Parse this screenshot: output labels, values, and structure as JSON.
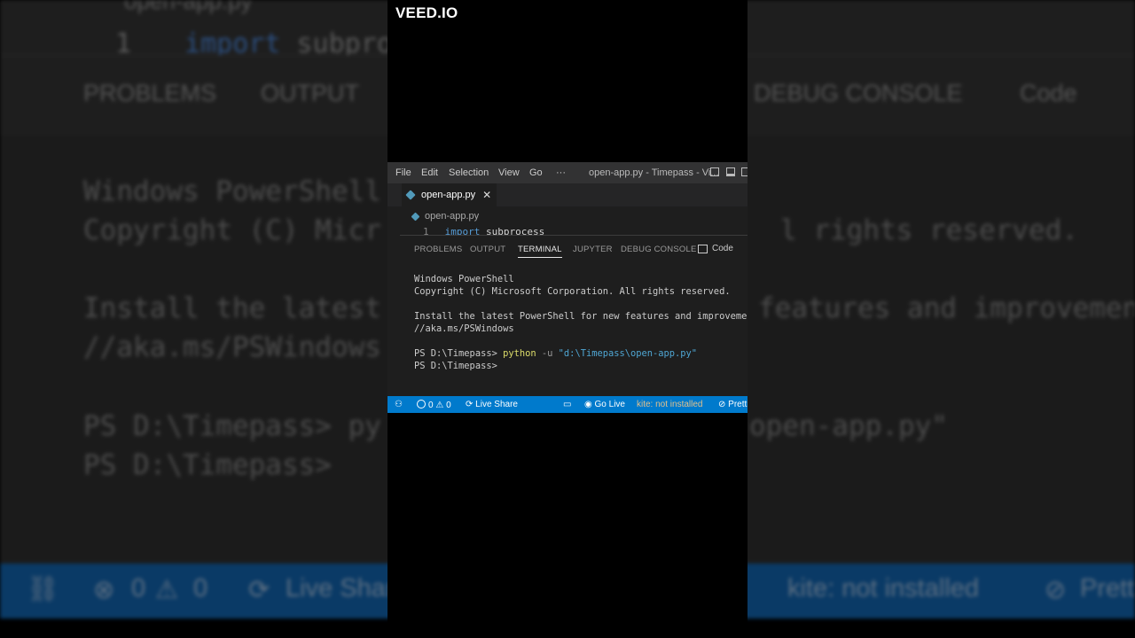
{
  "watermark": "VEED.IO",
  "menu": {
    "file": "File",
    "edit": "Edit",
    "selection": "Selection",
    "view": "View",
    "go": "Go",
    "more": "···"
  },
  "window_title": "open-app.py - Timepass - Vi...",
  "tab": {
    "label": "open-app.py",
    "close": "✕"
  },
  "breadcrumb": "open-app.py",
  "code_line": {
    "number": "1",
    "keyword": "import",
    "module": "subprocess"
  },
  "panel_tabs": {
    "problems": "PROBLEMS",
    "output": "OUTPUT",
    "terminal": "TERMINAL",
    "jupyter": "JUPYTER",
    "debug_console": "DEBUG CONSOLE",
    "code": "Code",
    "add": "+"
  },
  "terminal": {
    "line1": "Windows PowerShell",
    "line2": "Copyright (C) Microsoft Corporation. All rights reserved.",
    "line3": "Install the latest PowerShell for new features and improvements! https:",
    "line4": "//aka.ms/PSWindows",
    "prompt1": "PS D:\\Timepass> ",
    "cmd": "python",
    "flag": " -u ",
    "path": "\"d:\\Timepass\\open-app.py\"",
    "prompt2": "PS D:\\Timepass> "
  },
  "status": {
    "errors": "0",
    "warnings": "0",
    "live_share": "Live Share",
    "go_live": "Go Live",
    "kite": "kite: not installed",
    "prettier": "Prettier"
  },
  "bg": {
    "file": "open-app.py",
    "line_no": "1",
    "kw": "import",
    "mod": "subpro",
    "problems": "PROBLEMS",
    "output": "OUTPUT",
    "debug": "DEBUG CONSOLE",
    "code": "Code",
    "t1": "Windows PowerShell",
    "t2": "Copyright (C) Micr",
    "t2r": "l rights reserved.",
    "t3": "Install the latest",
    "t3r": "features and improvement",
    "t4": "//aka.ms/PSWindows",
    "p1": "PS D:\\Timepass> py",
    "p1r": "open-app.py\"",
    "p2": "PS D:\\Timepass>",
    "s_err": "0",
    "s_warn": "0",
    "s_live": "Live Shar",
    "s_kite": "kite: not installed",
    "s_pret": "Prett"
  },
  "colors": {
    "accent": "#007acc",
    "editor_bg": "#1e1e1e",
    "kite": "#e2c08d"
  }
}
